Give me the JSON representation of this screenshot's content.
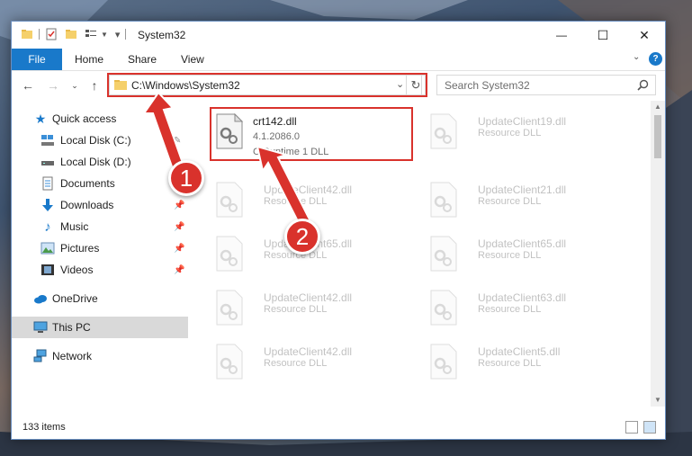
{
  "window": {
    "title": "System32",
    "controls": {
      "minimize": "—",
      "maximize": "☐",
      "close": "✕"
    }
  },
  "ribbon": {
    "tabs": [
      "File",
      "Home",
      "Share",
      "View"
    ],
    "help_icon": "?"
  },
  "address": {
    "path": "C:\\Windows\\System32",
    "search_placeholder": "Search System32"
  },
  "sidebar": {
    "items": [
      {
        "label": "Quick access",
        "icon": "star-icon"
      },
      {
        "label": "Local Disk (C:)",
        "icon": "drive-icon"
      },
      {
        "label": "Local Disk (D:)",
        "icon": "drive-icon"
      },
      {
        "label": "Documents",
        "icon": "document-icon"
      },
      {
        "label": "Downloads",
        "icon": "download-icon"
      },
      {
        "label": "Music",
        "icon": "music-icon"
      },
      {
        "label": "Pictures",
        "icon": "picture-icon"
      },
      {
        "label": "Videos",
        "icon": "video-icon"
      },
      {
        "label": "OneDrive",
        "icon": "cloud-icon"
      },
      {
        "label": "This PC",
        "icon": "computer-icon"
      },
      {
        "label": "Network",
        "icon": "network-icon"
      }
    ]
  },
  "files": [
    {
      "name": "crt142.dll",
      "version": "4.1.2086.0",
      "desc": "C Runtime 1 DLL"
    },
    {
      "name": "UpdateClient19.dll",
      "desc": "Resource DLL"
    },
    {
      "name": "UpdateClient42.dll",
      "desc": "Resource DLL"
    },
    {
      "name": "UpdateClient21.dll",
      "desc": "Resource DLL"
    },
    {
      "name": "UpdateClient65.dll",
      "desc": "Resource DLL"
    },
    {
      "name": "UpdateClient65.dll",
      "desc": "Resource DLL"
    },
    {
      "name": "UpdateClient42.dll",
      "desc": "Resource DLL"
    },
    {
      "name": "UpdateClient63.dll",
      "desc": "Resource DLL"
    },
    {
      "name": "UpdateClient42.dll",
      "desc": "Resource DLL"
    },
    {
      "name": "UpdateClient5.dll",
      "desc": "Resource DLL"
    }
  ],
  "status": {
    "count": "133 items"
  },
  "annotations": {
    "step1": "1",
    "step2": "2"
  },
  "colors": {
    "accent": "#1979ca",
    "highlight": "#d9322c"
  }
}
